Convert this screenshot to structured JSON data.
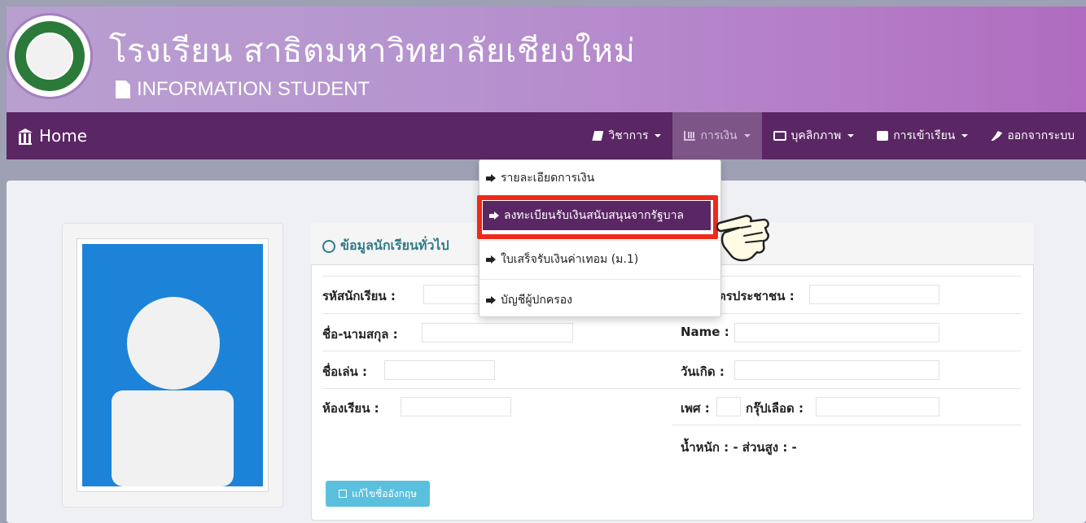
{
  "header": {
    "school_name": "โรงเรียน สาธิตมหาวิทยาลัยเชียงใหม่",
    "subtitle": "INFORMATION STUDENT"
  },
  "navbar": {
    "home_label": "Home",
    "items": [
      {
        "label": "วิชาการ",
        "icon": "book-icon",
        "active": false
      },
      {
        "label": "การเงิน",
        "icon": "bar-chart-icon",
        "active": true
      },
      {
        "label": "บุคลิกภาพ",
        "icon": "id-card-icon",
        "active": false
      },
      {
        "label": "การเข้าเรียน",
        "icon": "briefcase-icon",
        "active": false
      },
      {
        "label": "ออกจากระบบ",
        "icon": "plug-icon",
        "active": false
      }
    ]
  },
  "dropdown": {
    "items": [
      {
        "label": "รายละเอียดการเงิน",
        "highlighted": false
      },
      {
        "label": "ลงทะเบียนรับเงินสนับสนุนจากรัฐบาล",
        "highlighted": true
      },
      {
        "label": "ใบเสร็จรับเงินค่าเทอม (ม.1)",
        "highlighted": false
      },
      {
        "label": "บัญชีผู้ปกครอง",
        "highlighted": false
      }
    ]
  },
  "student_info": {
    "title": "ข้อมูลนักเรียนทั่วไป",
    "fields": {
      "student_id_label": "รหัสนักเรียน :",
      "fullname_label": "ชื่อ-นามสกุล :",
      "nickname_label": "ชื่อเล่น :",
      "classroom_label": "ห้องเรียน :",
      "citizen_id_label": "ัตรประชาชน :",
      "name_en_label": "Name :",
      "birthdate_label": "วันเกิด :",
      "gender_label": "เพศ :",
      "blood_label": "กรุ๊ปเลือด :",
      "weight_height": "น้ำหนัก : - ส่วนสูง : -"
    },
    "edit_button": "แก้ไขชื่ออังกฤษ"
  },
  "colors": {
    "navbar": "#5a2664",
    "highlight_frame": "#ee2a1a",
    "photo_bg": "#1c83d8",
    "edit_button": "#5bc0de"
  }
}
